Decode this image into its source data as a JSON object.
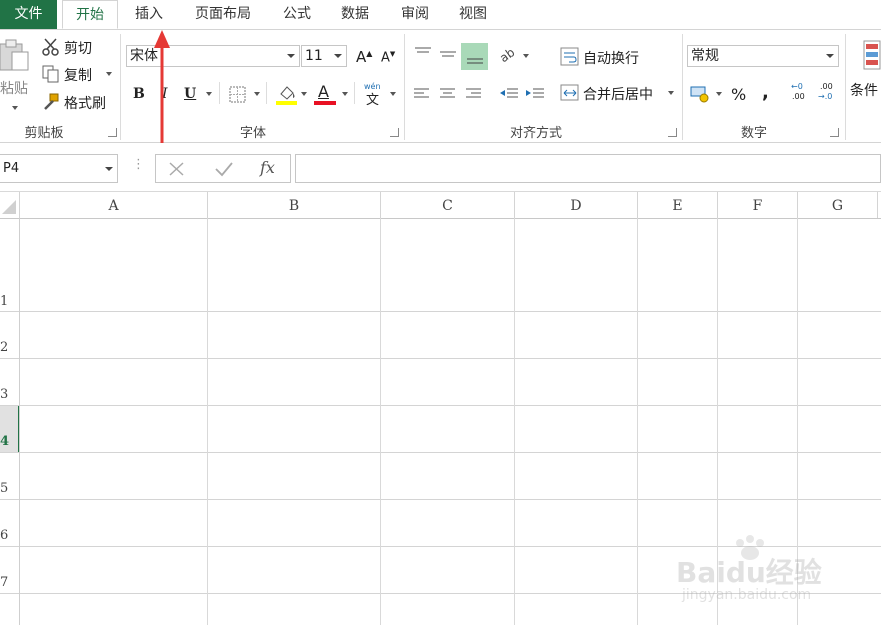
{
  "menu": {
    "file": "文件",
    "tabs": [
      "开始",
      "插入",
      "页面布局",
      "公式",
      "数据",
      "审阅",
      "视图"
    ]
  },
  "clipboard": {
    "paste": "粘贴",
    "cut": "剪切",
    "copy": "复制",
    "format_painter": "格式刷",
    "label": "剪贴板"
  },
  "font": {
    "name": "宋体",
    "size": "11",
    "grow": "A",
    "shrink": "A",
    "bold": "B",
    "italic": "I",
    "underline": "U",
    "font_color_letter": "A",
    "phonetic": "wén",
    "phonetic_char": "文",
    "label": "字体",
    "fill_color": "#ffff00",
    "font_color": "#e81123"
  },
  "alignment": {
    "wrap_text": "自动换行",
    "merge_center": "合并后居中",
    "label": "对齐方式"
  },
  "number": {
    "format": "常规",
    "percent": "%",
    "comma": ",",
    "inc_decimal_top": "←0",
    "inc_decimal_bottom": ".00",
    "dec_decimal_top": ".00",
    "dec_decimal_bottom": "→.0",
    "label": "数字"
  },
  "styles": {
    "conditional": "条件"
  },
  "formula_bar": {
    "name_box": "P4",
    "fx": "fx",
    "formula": ""
  },
  "columns": [
    "A",
    "B",
    "C",
    "D",
    "E",
    "F",
    "G"
  ],
  "rows": [
    "1",
    "2",
    "3",
    "4",
    "5",
    "6",
    "7"
  ],
  "active_row": "4",
  "accent": "#217346",
  "watermark": {
    "brand": "Baidu经验",
    "url": "jingyan.baidu.com"
  }
}
